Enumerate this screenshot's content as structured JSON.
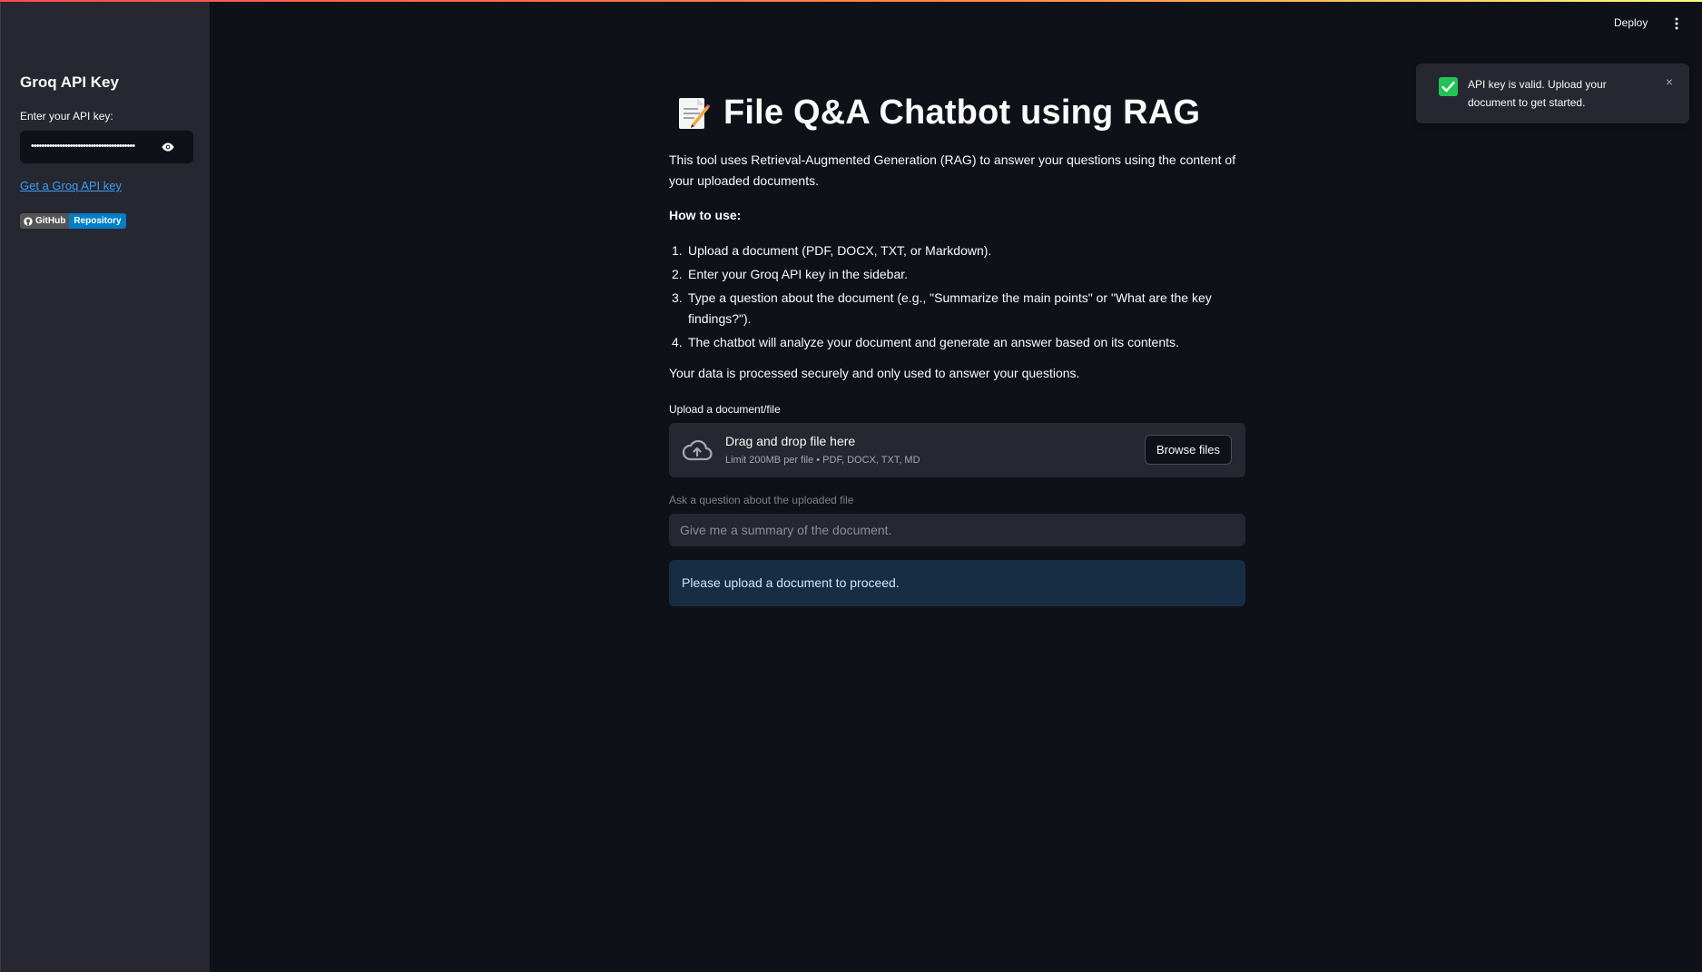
{
  "sidebar": {
    "title": "Groq API Key",
    "api_key_label": "Enter your API key:",
    "api_key_value": "••••••••••••••••••••••••••••••••••••••••",
    "link_text": "Get a Groq API key",
    "badge_left": "GitHub",
    "badge_right": "Repository"
  },
  "header": {
    "deploy_label": "Deploy",
    "menu_icon": "more-vertical-icon"
  },
  "toast": {
    "message": "API key is valid. Upload your document to get started.",
    "close_label": "×",
    "icon": "checkmark-icon"
  },
  "main": {
    "title": "File Q&A Chatbot using RAG",
    "title_icon": "memo-icon",
    "description": "This tool uses Retrieval-Augmented Generation (RAG) to answer your questions using the content of your uploaded documents.",
    "how_to_label": "How to use:",
    "steps": [
      {
        "num": "1.",
        "text": "Upload a document (PDF, DOCX, TXT, or Markdown)."
      },
      {
        "num": "2.",
        "text": "Enter your Groq API key in the sidebar."
      },
      {
        "num": "3.",
        "text": "Type a question about the document (e.g., \"Summarize the main points\" or \"What are the key findings?\")."
      },
      {
        "num": "4.",
        "text": "The chatbot will analyze your document and generate an answer based on its contents."
      }
    ],
    "privacy_note": "Your data is processed securely and only used to answer your questions.",
    "upload_label": "Upload a document/file",
    "dropzone_title": "Drag and drop file here",
    "dropzone_subtitle": "Limit 200MB per file • PDF, DOCX, TXT, MD",
    "browse_label": "Browse files",
    "question_label": "Ask a question about the uploaded file",
    "question_placeholder": "Give me a summary of the document.",
    "info_message": "Please upload a document to proceed."
  },
  "colors": {
    "background": "#0e1117",
    "sidebar": "#262730",
    "accent_link": "#3d9df3",
    "success": "#21c354",
    "info_bg": "#172d43",
    "info_text": "#c7ebff"
  }
}
